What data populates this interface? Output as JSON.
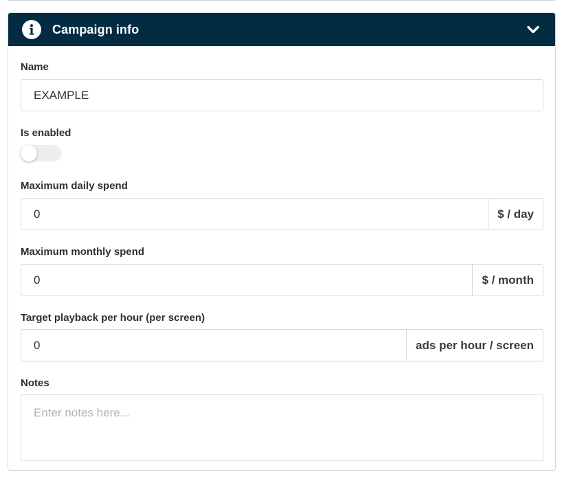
{
  "panel": {
    "title": "Campaign info",
    "header_color": "#032b42"
  },
  "fields": {
    "name": {
      "label": "Name",
      "value": "EXAMPLE"
    },
    "enabled": {
      "label": "Is enabled",
      "checked": false
    },
    "daily_spend": {
      "label": "Maximum daily spend",
      "value": "0",
      "unit": "$ / day"
    },
    "monthly_spend": {
      "label": "Maximum monthly spend",
      "value": "0",
      "unit": "$ / month"
    },
    "target_playback": {
      "label": "Target playback per hour (per screen)",
      "value": "0",
      "unit": "ads per hour / screen"
    },
    "notes": {
      "label": "Notes",
      "placeholder": "Enter notes here..."
    }
  },
  "icons": {
    "header_left": "info-icon",
    "header_right": "chevron-down-icon"
  }
}
